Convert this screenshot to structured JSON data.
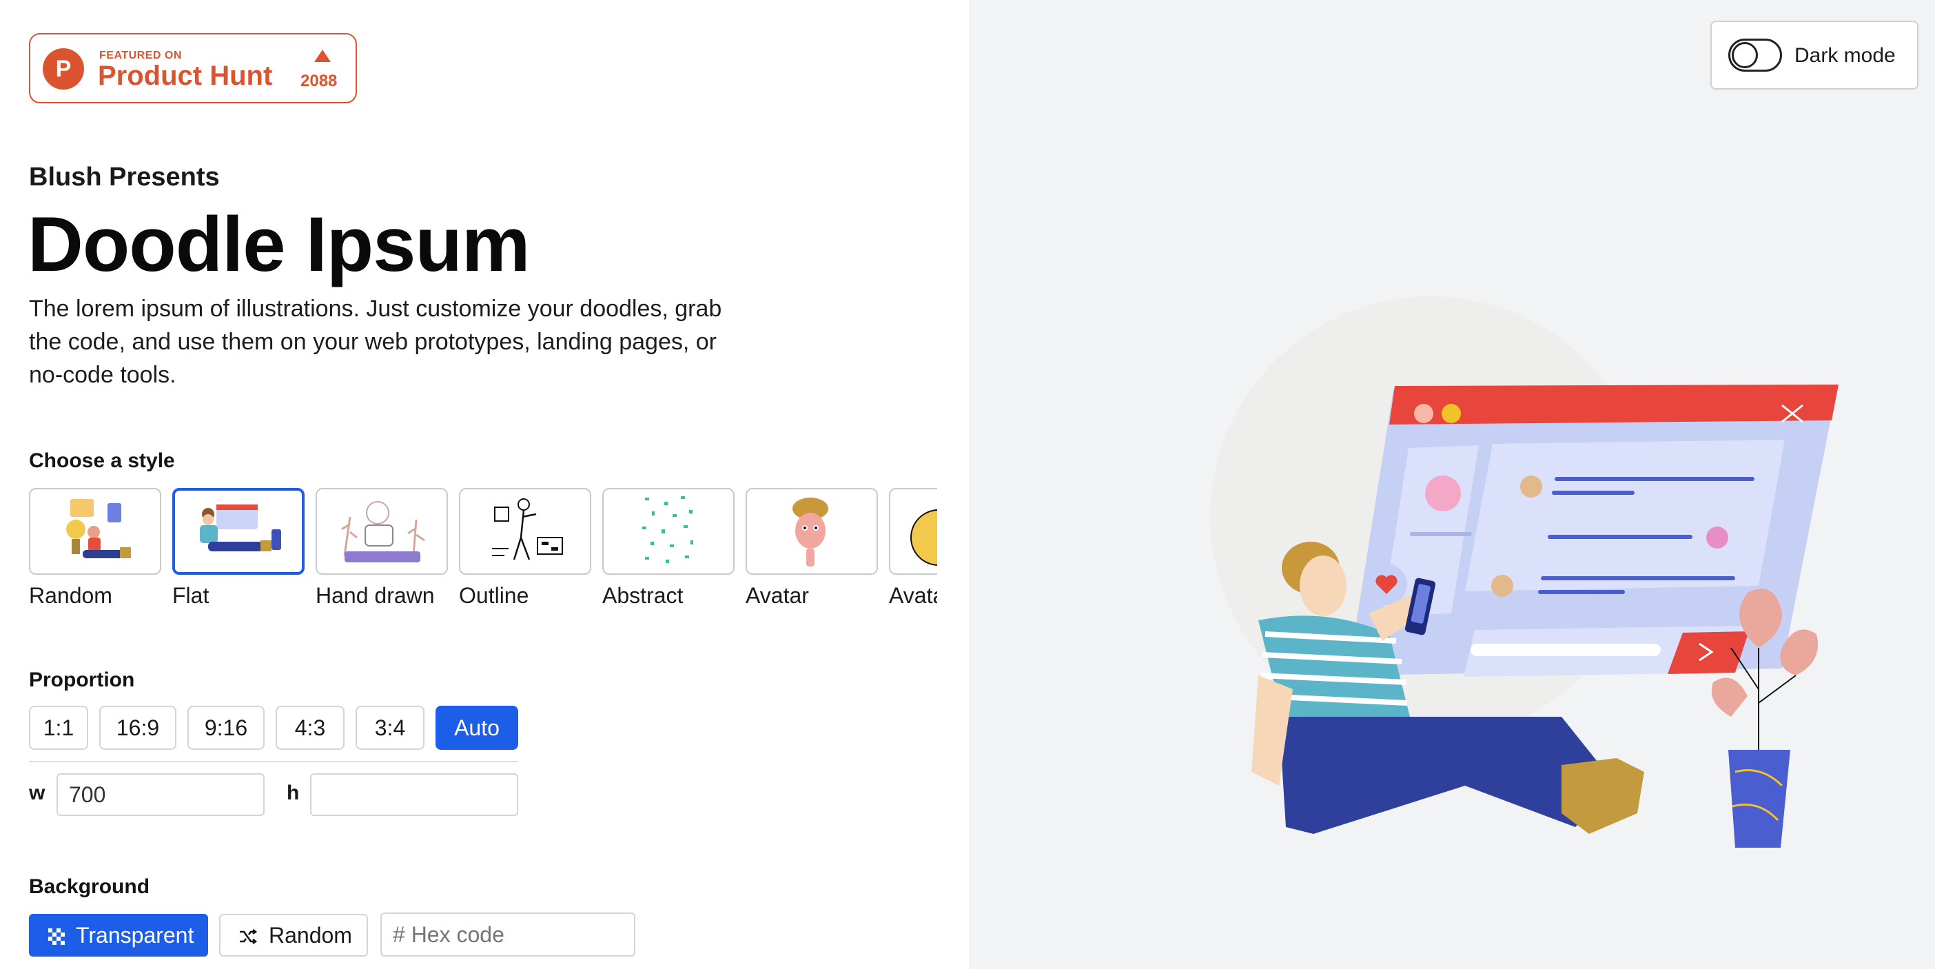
{
  "badge": {
    "featured": "FEATURED ON",
    "name": "Product Hunt",
    "count": "2088",
    "logo_letter": "P",
    "color": "#da552f"
  },
  "hero": {
    "presents": "Blush Presents",
    "title": "Doodle Ipsum",
    "description": "The lorem ipsum of illustrations. Just customize your doodles, grab the code, and use them on your web prototypes, landing pages, or no-code tools."
  },
  "styles": {
    "label": "Choose a style",
    "items": [
      {
        "label": "Random",
        "selected": false
      },
      {
        "label": "Flat",
        "selected": true
      },
      {
        "label": "Hand drawn",
        "selected": false
      },
      {
        "label": "Outline",
        "selected": false
      },
      {
        "label": "Abstract",
        "selected": false
      },
      {
        "label": "Avatar",
        "selected": false
      },
      {
        "label": "Avata",
        "selected": false
      }
    ]
  },
  "proportion": {
    "label": "Proportion",
    "options": [
      "1:1",
      "16:9",
      "9:16",
      "4:3",
      "3:4",
      "Auto"
    ],
    "active": "Auto",
    "w_label": "w",
    "h_label": "h",
    "w_value": "700",
    "h_value": ""
  },
  "background": {
    "label": "Background",
    "transparent_label": "Transparent",
    "random_label": "Random",
    "hex_placeholder": "# Hex code"
  },
  "dark_mode": {
    "label": "Dark mode",
    "enabled": false
  },
  "colors": {
    "accent": "#1d5ee8",
    "badge": "#da552f",
    "right_bg": "#f2f3f5"
  }
}
